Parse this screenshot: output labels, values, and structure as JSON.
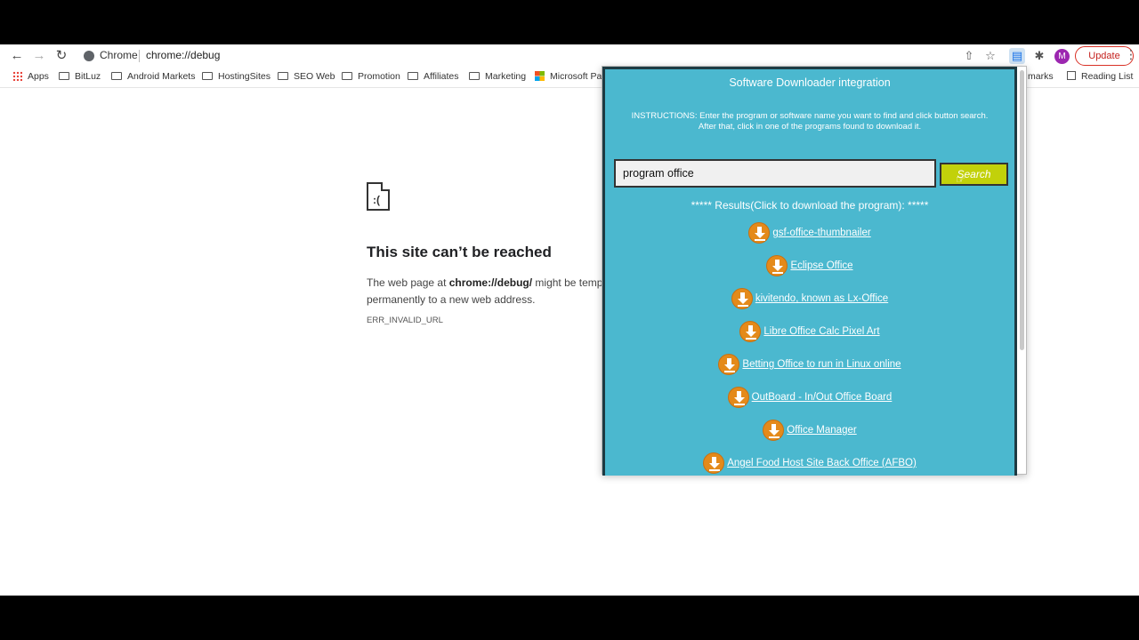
{
  "toolbar": {
    "site_chip": "Chrome",
    "url": "chrome://debug",
    "update_label": "Update",
    "avatar_letter": "M"
  },
  "bookmarks": [
    {
      "label": "Apps",
      "icon": "apps-grid-icon"
    },
    {
      "label": "BitLuz",
      "icon": "folder-icon"
    },
    {
      "label": "Android Markets",
      "icon": "folder-icon"
    },
    {
      "label": "HostingSites",
      "icon": "folder-icon"
    },
    {
      "label": "SEO Web",
      "icon": "folder-icon"
    },
    {
      "label": "Promotion",
      "icon": "folder-icon"
    },
    {
      "label": "Affiliates",
      "icon": "folder-icon"
    },
    {
      "label": "Marketing",
      "icon": "folder-icon"
    },
    {
      "label": "Microsoft Pa",
      "icon": "microsoft-icon"
    },
    {
      "label": "marks",
      "icon": ""
    },
    {
      "label": "Reading List",
      "icon": "reading-list-icon"
    }
  ],
  "error_page": {
    "title": "This site can’t be reached",
    "text_before": "The web page at ",
    "url_bold": "chrome://debug/",
    "text_after": " might be temp",
    "text_line2": "permanently to a new web address.",
    "code": "ERR_INVALID_URL"
  },
  "popup": {
    "title": "Software Downloader integration",
    "instructions_line1": "INSTRUCTIONS: Enter the program or software name you want to find and click button search.",
    "instructions_line2": "After that, click in one of the programs found to download it.",
    "search_value": "program office",
    "search_button": "Search",
    "results_header": "***** Results(Click to download the program): *****",
    "results": [
      "gsf-office-thumbnailer",
      " Eclipse Office",
      " kivitendo, known as Lx-Office",
      " Libre Office Calc Pixel Art",
      " Betting Office to run in Linux online",
      " OutBoard - In/Out Office Board",
      " Office Manager",
      " Angel Food Host Site Back Office (AFBO)"
    ]
  }
}
